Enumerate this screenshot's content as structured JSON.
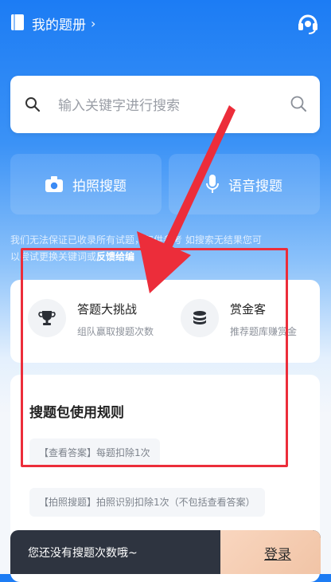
{
  "header": {
    "title": "我的题册",
    "chevron": "›",
    "book_icon": "book-icon",
    "service_icon": "headset-icon"
  },
  "search": {
    "placeholder": "输入关键字进行搜索",
    "left_icon": "search-icon",
    "right_icon": "search-icon"
  },
  "actions": {
    "photo_label": "拍照搜题",
    "photo_icon": "camera-icon",
    "voice_label": "语音搜题",
    "voice_icon": "microphone-icon"
  },
  "disclaimer": {
    "line1": "我们无法保证已收录所有试题，",
    "line1_cont": "仅供参考 如搜索无结果您可",
    "line2": "以尝试更换关键词或",
    "feedback_link": "反馈给编"
  },
  "features": [
    {
      "title": "答题大挑战",
      "subtitle": "组队赢取搜题次数",
      "icon": "trophy-icon"
    },
    {
      "title": "赏金客",
      "subtitle": "推荐题库赚赏金",
      "icon": "coins-icon"
    }
  ],
  "rules": {
    "title": "搜题包使用规则",
    "items": [
      "【查看答案】每题扣除1次",
      "【拍照搜题】拍照识别扣除1次（不包括查看答案）"
    ]
  },
  "bottom": {
    "message": "您还没有搜题次数哦~",
    "login_label": "登录"
  },
  "colors": {
    "brand_blue": "#1C7CF4",
    "annotation_red": "#EC2D3A",
    "bar_dark": "#2E3440",
    "login_peach": "#F5CDB2"
  }
}
